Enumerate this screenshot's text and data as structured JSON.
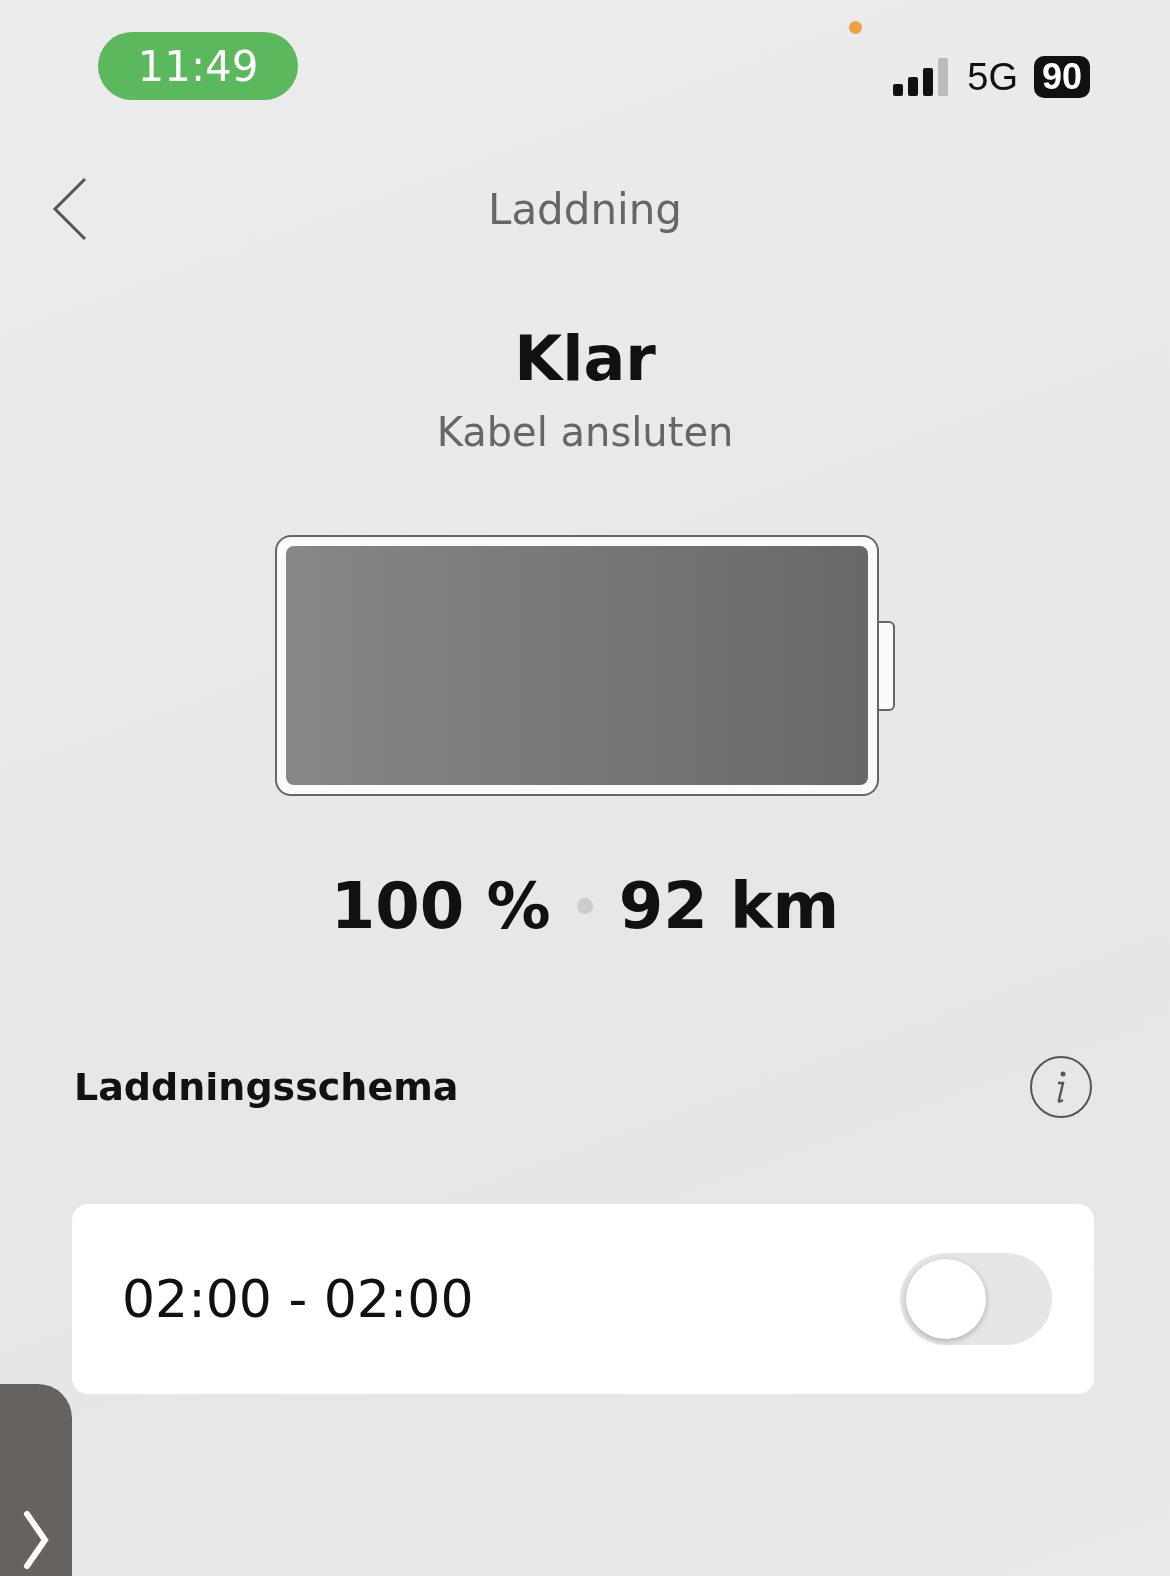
{
  "status_bar": {
    "time": "11:49",
    "network": "5G",
    "battery": "90"
  },
  "header": {
    "title": "Laddning"
  },
  "status": {
    "title": "Klar",
    "subtitle": "Kabel ansluten"
  },
  "readings": {
    "charge": "100 %",
    "range": "92 km"
  },
  "schedule": {
    "title": "Laddningsschema",
    "entries": [
      {
        "time": "02:00 - 02:00",
        "on": false
      }
    ]
  }
}
